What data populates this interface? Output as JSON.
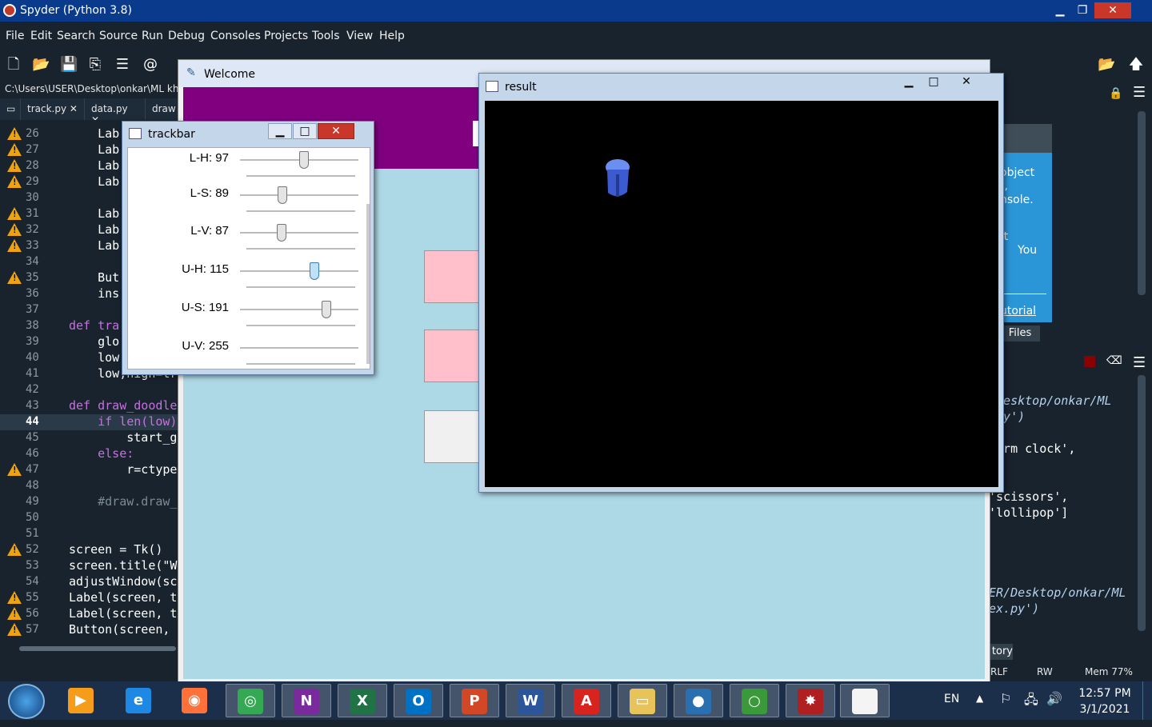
{
  "spyder": {
    "title": "Spyder (Python 3.8)",
    "menu": [
      "File",
      "Edit",
      "Search",
      "Source",
      "Run",
      "Debug",
      "Consoles",
      "Projects",
      "Tools",
      "View",
      "Help"
    ],
    "path": "C:\\Users\\USER\\Desktop\\onkar\\ML kha",
    "tabs": [
      "track.py",
      "data.py",
      "draw"
    ],
    "editor_lines": [
      {
        "n": "26",
        "warn": true,
        "code": "    Lab"
      },
      {
        "n": "27",
        "warn": true,
        "code": "    Lab"
      },
      {
        "n": "28",
        "warn": true,
        "code": "    Lab"
      },
      {
        "n": "29",
        "warn": true,
        "code": "    Lab"
      },
      {
        "n": "30",
        "warn": false,
        "code": ""
      },
      {
        "n": "31",
        "warn": true,
        "code": "    Lab"
      },
      {
        "n": "32",
        "warn": true,
        "code": "    Lab"
      },
      {
        "n": "33",
        "warn": true,
        "code": "    Lab"
      },
      {
        "n": "34",
        "warn": false,
        "code": ""
      },
      {
        "n": "35",
        "warn": true,
        "code": "    But"
      },
      {
        "n": "36",
        "warn": false,
        "code": "    ins"
      },
      {
        "n": "37",
        "warn": false,
        "code": ""
      },
      {
        "n": "38",
        "warn": false,
        "code": "def tra"
      },
      {
        "n": "39",
        "warn": false,
        "code": "    glo"
      },
      {
        "n": "40",
        "warn": false,
        "code": "    low"
      },
      {
        "n": "41",
        "warn": false,
        "code": "    low,high=tr"
      },
      {
        "n": "42",
        "warn": false,
        "code": ""
      },
      {
        "n": "43",
        "warn": false,
        "code": "def draw_doodle"
      },
      {
        "n": "44",
        "warn": false,
        "code": "    if len(low)"
      },
      {
        "n": "45",
        "warn": false,
        "code": "        start_g"
      },
      {
        "n": "46",
        "warn": false,
        "code": "    else:"
      },
      {
        "n": "47",
        "warn": true,
        "code": "        r=ctype"
      },
      {
        "n": "48",
        "warn": false,
        "code": ""
      },
      {
        "n": "49",
        "warn": false,
        "code": "    #draw.draw_"
      },
      {
        "n": "50",
        "warn": false,
        "code": ""
      },
      {
        "n": "51",
        "warn": false,
        "code": ""
      },
      {
        "n": "52",
        "warn": true,
        "code": "screen = Tk()"
      },
      {
        "n": "53",
        "warn": false,
        "code": "screen.title(\"W"
      },
      {
        "n": "54",
        "warn": false,
        "code": "adjustWindow(sc"
      },
      {
        "n": "55",
        "warn": true,
        "code": "Label(screen, t"
      },
      {
        "n": "56",
        "warn": true,
        "code": "Label(screen, t"
      },
      {
        "n": "57",
        "warn": true,
        "code": "Button(screen, "
      }
    ],
    "help_text": [
      "object",
      "t,",
      "nsole.",
      "ft",
      "You",
      "utorial"
    ],
    "files_tab": "Files",
    "console_lines": [
      "/Desktop/onkar/ML",
      ".py')",
      "larm clock',",
      "]",
      "'scissors',",
      "'lollipop']",
      "ER/Desktop/onkar/ML",
      "ex.py')"
    ],
    "history_tab": "tory",
    "status": {
      "eol": "RLF",
      "rw": "RW",
      "mem": "Mem 77%"
    }
  },
  "welcome": {
    "title": "Welcome"
  },
  "trackbar": {
    "title": "trackbar",
    "sliders": [
      {
        "label": "L-H: 97",
        "value": 97,
        "max": 179
      },
      {
        "label": "L-S: 89",
        "value": 89,
        "max": 255
      },
      {
        "label": "L-V: 87",
        "value": 87,
        "max": 255
      },
      {
        "label": "U-H: 115",
        "value": 115,
        "max": 179
      },
      {
        "label": "U-S: 191",
        "value": 191,
        "max": 255
      },
      {
        "label": "U-V: 255",
        "value": 255,
        "max": 255
      }
    ]
  },
  "result": {
    "title": "result"
  },
  "taskbar": {
    "apps": [
      "Windows Media Player",
      "Internet Explorer",
      "Firefox",
      "Chrome",
      "OneNote",
      "Excel",
      "Outlook",
      "PowerPoint",
      "Word",
      "Adobe Acrobat",
      "File Explorer",
      "Windows Media Center",
      "Spyder Task",
      "Spyder",
      "Notepad"
    ],
    "language": "EN",
    "time": "12:57 PM",
    "date": "3/1/2021"
  }
}
